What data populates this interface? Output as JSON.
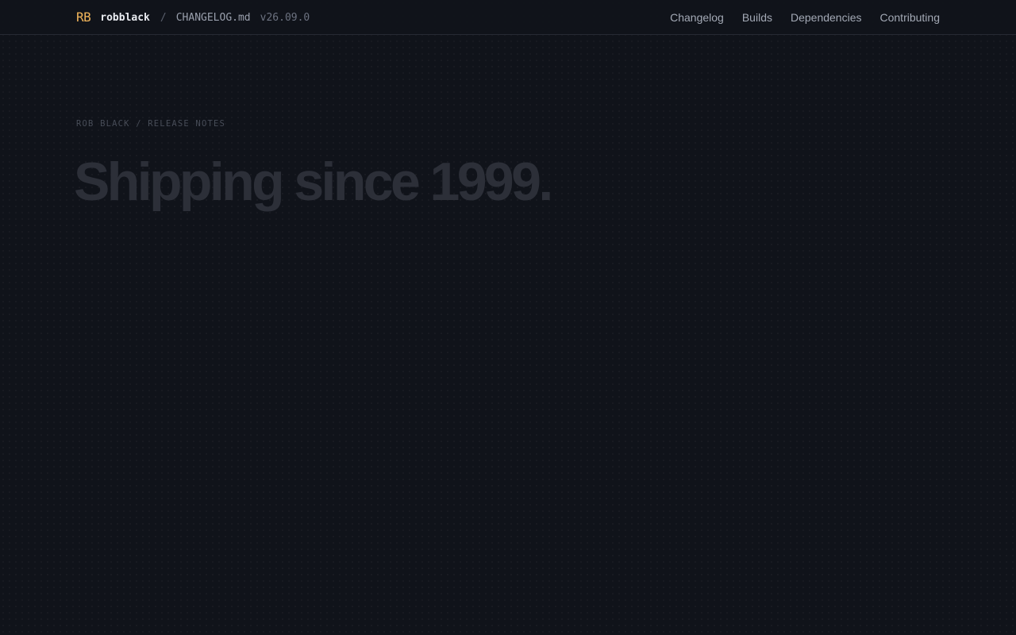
{
  "header": {
    "logo": "RB",
    "user": "robblack",
    "separator": "/",
    "file": "CHANGELOG.md",
    "version": "v26.09.0"
  },
  "nav": {
    "items": [
      "Changelog",
      "Builds",
      "Dependencies",
      "Contributing"
    ]
  },
  "hero": {
    "eyebrow": "ROB BLACK / RELEASE NOTES",
    "headline": "Shipping since 1999."
  },
  "colors": {
    "background": "#10131a",
    "accent": "#f0b45a",
    "headline": "#2c2f38"
  }
}
